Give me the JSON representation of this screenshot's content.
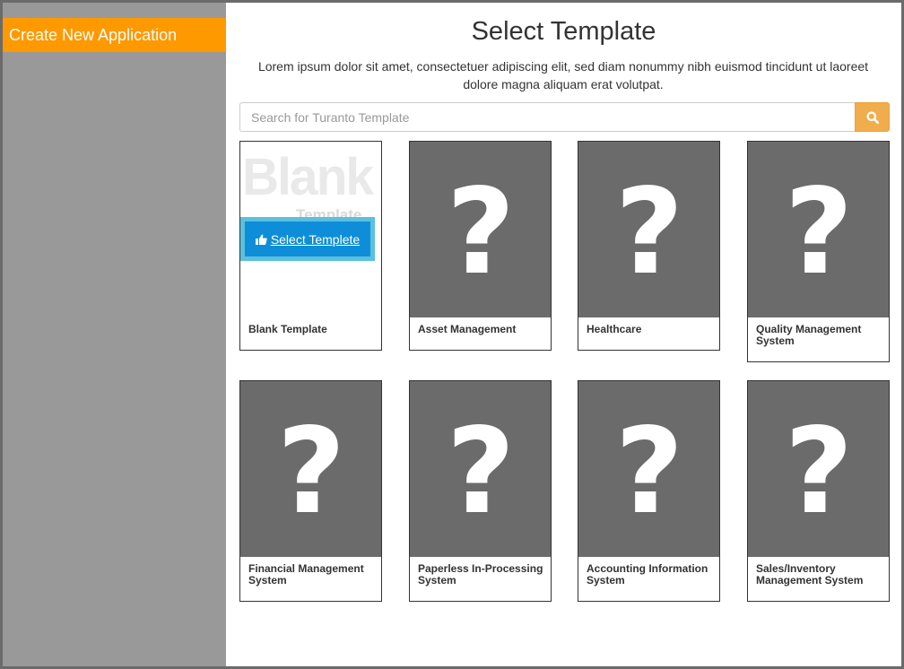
{
  "sidebar": {
    "header": "Create New Application"
  },
  "main": {
    "title": "Select Template",
    "description": "Lorem ipsum dolor sit amet, consectetuer adipiscing elit, sed diam nonummy nibh euismod tincidunt ut laoreet dolore magna aliquam erat volutpat.",
    "search": {
      "placeholder": "Search for Turanto Template",
      "value": ""
    },
    "blank_card": {
      "thumb_word": "Blank",
      "thumb_sub": "Template",
      "select_label": "Select Templete",
      "title": "Blank Template"
    },
    "templates": [
      {
        "title": "Asset Management"
      },
      {
        "title": "Healthcare"
      },
      {
        "title": "Quality Management System"
      },
      {
        "title": "Financial Management System"
      },
      {
        "title": "Paperless In-Processing System"
      },
      {
        "title": "Accounting Information System"
      },
      {
        "title": "Sales/Inventory Management System"
      }
    ]
  },
  "colors": {
    "accent": "#ff9900",
    "sidebar_bg": "#999999",
    "search_button": "#f0ad4e",
    "select_button": "#0e8ed8",
    "thumb_bg": "#6b6b6b"
  },
  "icons": {
    "search": "search-icon",
    "thumbs_up": "thumbs-up-icon",
    "question": "question-mark-icon"
  }
}
